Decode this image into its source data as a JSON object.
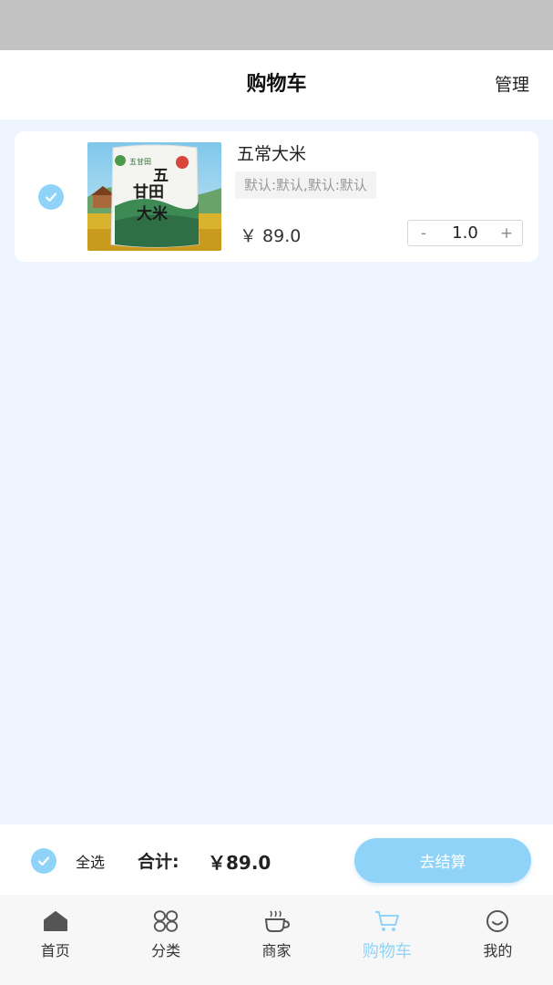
{
  "header": {
    "title": "购物车",
    "manage_label": "管理"
  },
  "cart": {
    "items": [
      {
        "name": "五常大米",
        "spec": "默认:默认,默认:默认",
        "price": "￥ 89.0",
        "quantity": "1.0",
        "minus_label": "-",
        "plus_label": "+",
        "checked": true,
        "package_text": {
          "top": "五甘田",
          "l1": "五",
          "l2": "甘田",
          "l3": "大米"
        }
      }
    ]
  },
  "footer": {
    "select_all_label": "全选",
    "total_label": "合计:",
    "total_value": "￥89.0",
    "checkout_label": "去结算"
  },
  "tabbar": {
    "items": [
      {
        "label": "首页",
        "icon": "home-icon",
        "active": false
      },
      {
        "label": "分类",
        "icon": "category-icon",
        "active": false
      },
      {
        "label": "商家",
        "icon": "cup-icon",
        "active": false
      },
      {
        "label": "购物车",
        "icon": "cart-icon",
        "active": true
      },
      {
        "label": "我的",
        "icon": "smile-icon",
        "active": false
      }
    ]
  },
  "colors": {
    "accent": "#8fd3f8",
    "background": "#eef4fd",
    "status_bar": "#c2c2c2"
  }
}
